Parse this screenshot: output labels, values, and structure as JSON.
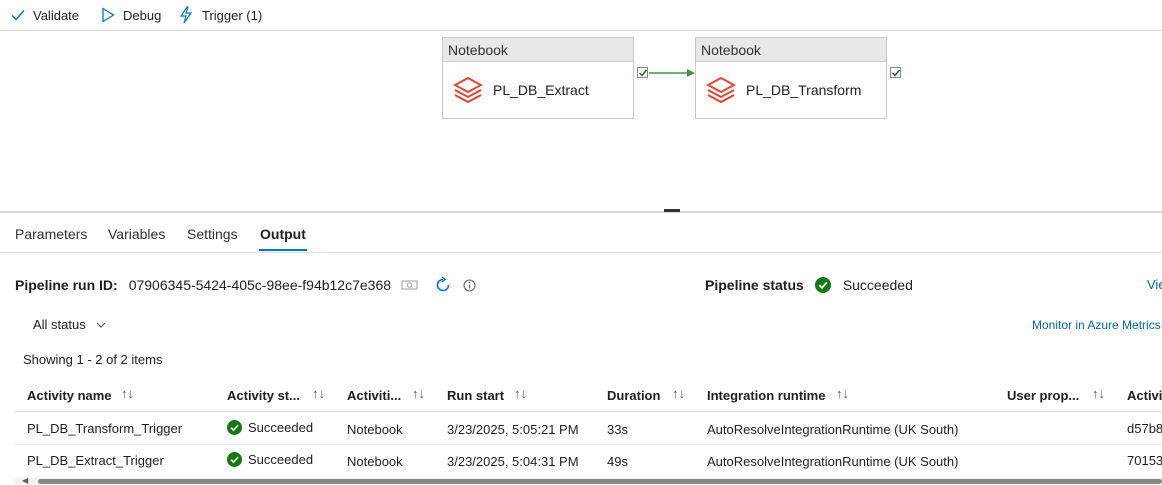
{
  "toolbar": {
    "validate": "Validate",
    "debug": "Debug",
    "trigger": "Trigger (1)"
  },
  "pipeline": {
    "nodes": [
      {
        "type": "Notebook",
        "name": "PL_DB_Extract"
      },
      {
        "type": "Notebook",
        "name": "PL_DB_Transform"
      }
    ]
  },
  "tabs": [
    "Parameters",
    "Variables",
    "Settings",
    "Output"
  ],
  "active_tab": "Output",
  "output": {
    "run_id_label": "Pipeline run ID:",
    "run_id": "07906345-5424-405c-98ee-f94b12c7e368",
    "status_label": "Pipeline status",
    "status": "Succeeded",
    "view_link": "Vie",
    "filter": "All status",
    "monitor_link": "Monitor in Azure Metrics",
    "showing": "Showing 1 - 2 of 2 items"
  },
  "table": {
    "columns": [
      "Activity name",
      "Activity st...",
      "Activiti...",
      "Run start",
      "Duration",
      "Integration runtime",
      "User prop...",
      "Activit"
    ],
    "rows": [
      [
        "PL_DB_Transform_Trigger",
        "Succeeded",
        "Notebook",
        "3/23/2025, 5:05:21 PM",
        "33s",
        "AutoResolveIntegrationRuntime (UK South)",
        "",
        "d57b8"
      ],
      [
        "PL_DB_Extract_Trigger",
        "Succeeded",
        "Notebook",
        "3/23/2025, 5:04:31 PM",
        "49s",
        "AutoResolveIntegrationRuntime (UK South)",
        "",
        "70153"
      ]
    ]
  },
  "colors": {
    "accent": "#0078d4",
    "success": "#107c10",
    "databricks": "#e8432e",
    "connector": "#3c9a3c"
  }
}
